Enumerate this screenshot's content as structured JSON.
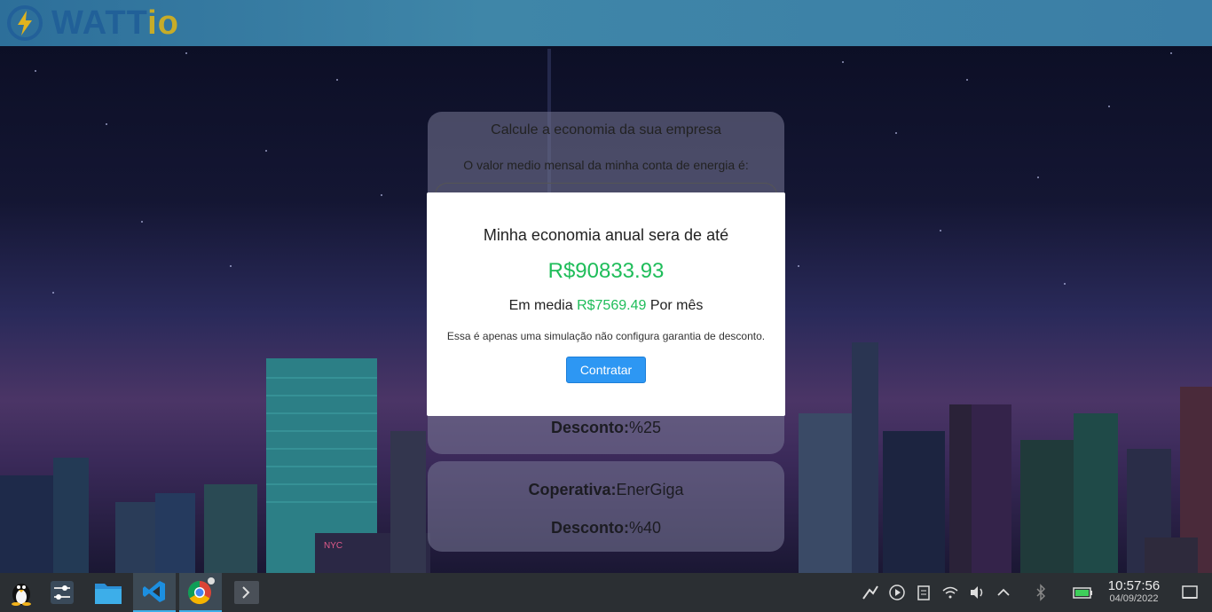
{
  "header": {
    "logo_main": "WATT",
    "logo_suffix": "io"
  },
  "calculator": {
    "title": "Calcule a economia da sua empresa",
    "input_label": "O valor medio mensal da minha conta de energia é:",
    "discount_label": "Desconto:",
    "discount_value": "%25"
  },
  "coop_card": {
    "coop_label": "Coperativa:",
    "coop_value": "EnerGiga",
    "discount_label": "Desconto:",
    "discount_value": "%40"
  },
  "modal": {
    "title": "Minha economia anual sera de até",
    "annual_value": "R$90833.93",
    "avg_prefix": "Em media",
    "monthly_value": "R$7569.49",
    "avg_suffix": "Por mês",
    "disclaimer": "Essa é apenas uma simulação não configura garantia de desconto.",
    "button_label": "Contratar"
  },
  "scene": {
    "sign_text": "NYC"
  },
  "taskbar": {
    "apps": [
      {
        "name": "app-launcher",
        "icon": "linux-tux-icon"
      },
      {
        "name": "system-settings",
        "icon": "sliders-icon"
      },
      {
        "name": "file-manager",
        "icon": "folder-icon"
      },
      {
        "name": "vscode",
        "icon": "vscode-icon"
      },
      {
        "name": "chrome",
        "icon": "chrome-icon"
      },
      {
        "name": "terminal",
        "icon": "terminal-icon"
      }
    ],
    "clock_time": "10:57:56",
    "clock_date": "04/09/2022"
  },
  "colors": {
    "accent_green": "#1fbd5a",
    "button_blue": "#2d97f3",
    "header_blue": "#3b7ea6"
  }
}
